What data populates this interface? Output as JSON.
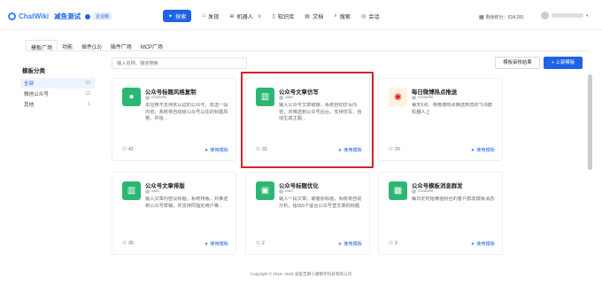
{
  "brand": {
    "logo_text": "ChatWiki",
    "app_name": "减鱼测试",
    "env_badge": "企业版"
  },
  "nav": [
    {
      "label": "探索",
      "icon": "compass-icon",
      "active": true
    },
    {
      "label": "发现",
      "icon": "home-icon"
    },
    {
      "label": "机器人",
      "icon": "robot-icon",
      "caret": true
    },
    {
      "label": "知识库",
      "icon": "book-icon"
    },
    {
      "label": "文档",
      "icon": "document-icon"
    },
    {
      "label": "搜索",
      "icon": "search-icon"
    },
    {
      "label": "会话",
      "icon": "chat-icon"
    }
  ],
  "credits": {
    "label": "剩余积分：",
    "value": "534,281"
  },
  "tabs": [
    "模板广场",
    "功能",
    "插件(13)",
    "插件广场",
    "MCP广场"
  ],
  "sidebar": {
    "title": "模板分类",
    "items": [
      {
        "label": "全部",
        "count": "13",
        "active": true
      },
      {
        "label": "微信公众号",
        "count": "12"
      },
      {
        "label": "其他",
        "count": "1"
      }
    ]
  },
  "search": {
    "placeholder": "输入名称、描述搜索"
  },
  "buttons": {
    "review_results": "模板审核结果",
    "upload_template": "+ 上架模板"
  },
  "cards": [
    {
      "title": "公众号标题风格复制",
      "author": "chatwiki",
      "desc": "本应用不支持未认证的公众号，发送一段内容，系统将自动给公众号以往的标题风格，并给...",
      "uses": "41",
      "use_label": "使用模板",
      "color": "#2bb673"
    },
    {
      "title": "公众号文章仿写",
      "author": "alan",
      "desc": "输入公众号文章链接，系统自动仿写内容，并推送到公众号后台。支持仿写、自动生成主题...",
      "uses": "31",
      "use_label": "使用模板",
      "color": "#2bb673"
    },
    {
      "title": "每日微博热点推送",
      "author": "chatwiki",
      "desc": "每天9点，将微博热点推送到您的飞书群机器人上",
      "uses": "20",
      "use_label": "使用模板",
      "color": "#f5b71c"
    },
    {
      "title": "公众号文章排版",
      "author": "alan",
      "desc": "输入文章内容及标题，系统排版，并推送到公众号草稿，并支持同指定用户等...",
      "uses": "30",
      "use_label": "使用模板",
      "color": "#2bb673"
    },
    {
      "title": "公众号标题优化",
      "author": "alan",
      "desc": "输入一段文章，或者原标题，系统将自动分析，给出5个适合公众号营文章的标题",
      "uses": "2",
      "use_label": "使用模板",
      "color": "#2bb673"
    },
    {
      "title": "公众号模板消息群发",
      "author": "chatwiki",
      "desc": "每日定时给微信粉丝的客户群发模板消息",
      "uses": "2",
      "use_label": "使用模板",
      "color": "#2bb673"
    }
  ],
  "footer": "Copyright © 2016- 2025 减鱼芝麻小睿数字科技有限公司"
}
